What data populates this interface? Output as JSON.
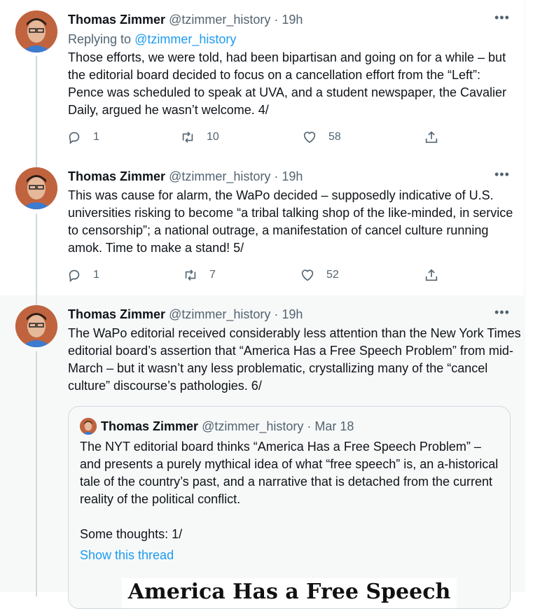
{
  "tweets": [
    {
      "author": "Thomas Zimmer",
      "handle": "@tzimmer_history",
      "sep": "·",
      "time": "19h",
      "reply_prefix": "Replying to",
      "reply_handle": "@tzimmer_history",
      "text": "Those efforts, we were told, had been bipartisan and going on for a while – but the editorial board decided to focus on a cancellation effort from the “Left”: Pence was scheduled to speak at UVA, and a student newspaper, the Cavalier Daily, argued he wasn’t welcome. 4/",
      "replies": "1",
      "retweets": "10",
      "likes": "58"
    },
    {
      "author": "Thomas Zimmer",
      "handle": "@tzimmer_history",
      "sep": "·",
      "time": "19h",
      "text": "This was cause for alarm, the WaPo decided – supposedly indicative of U.S. universities risking to become “a tribal talking shop of the like-minded, in service to censorship”; a national outrage, a manifestation of cancel culture running amok. Time to make a stand! 5/",
      "replies": "1",
      "retweets": "7",
      "likes": "52"
    },
    {
      "author": "Thomas Zimmer",
      "handle": "@tzimmer_history",
      "sep": "·",
      "time": "19h",
      "text": "The WaPo editorial received considerably less attention than the New York Times editorial board’s assertion that “America Has a Free Speech Problem” from mid-March – but it wasn’t any less problematic, crystallizing many of the “cancel culture” discourse’s pathologies. 6/"
    }
  ],
  "quote": {
    "author": "Thomas Zimmer",
    "handle": "@tzimmer_history",
    "sep": "·",
    "date": "Mar 18",
    "text": "The NYT editorial board thinks “America Has a Free Speech Problem” – and presents a purely mythical idea of what “free speech” is, an a-historical tale of the country’s past, and a narrative that is detached from the current reality of the political conflict.",
    "text2": "Some thoughts: 1/",
    "show_thread": "Show this thread",
    "image_headline": "America Has a Free Speech"
  },
  "icons": {
    "more": "more-icon",
    "reply": "reply-icon",
    "retweet": "retweet-icon",
    "like": "like-icon",
    "share": "share-icon"
  },
  "colors": {
    "link": "#1d9bf0",
    "secondary": "#536471",
    "highlight_bg": "#f7f9f9"
  }
}
